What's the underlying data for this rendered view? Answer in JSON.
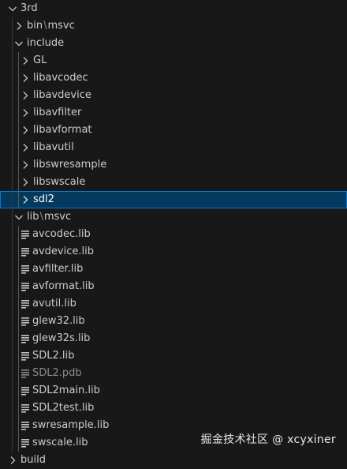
{
  "explorer": {
    "root": {
      "label": "3rd"
    },
    "bin": {
      "part1": "bin",
      "sep": "\\",
      "part2": "msvc"
    },
    "include": {
      "label": "include"
    },
    "include_items": [
      {
        "label": "GL"
      },
      {
        "label": "libavcodec"
      },
      {
        "label": "libavdevice"
      },
      {
        "label": "libavfilter"
      },
      {
        "label": "libavformat"
      },
      {
        "label": "libavutil"
      },
      {
        "label": "libswresample"
      },
      {
        "label": "libswscale"
      },
      {
        "label": "sdl2"
      }
    ],
    "lib": {
      "part1": "lib",
      "sep": "\\",
      "part2": "msvc"
    },
    "lib_files": [
      {
        "label": "avcodec.lib"
      },
      {
        "label": "avdevice.lib"
      },
      {
        "label": "avfilter.lib"
      },
      {
        "label": "avformat.lib"
      },
      {
        "label": "avutil.lib"
      },
      {
        "label": "glew32.lib"
      },
      {
        "label": "glew32s.lib"
      },
      {
        "label": "SDL2.lib"
      },
      {
        "label": "SDL2.pdb"
      },
      {
        "label": "SDL2main.lib"
      },
      {
        "label": "SDL2test.lib"
      },
      {
        "label": "swresample.lib"
      },
      {
        "label": "swscale.lib"
      }
    ],
    "build": {
      "label": "build"
    }
  },
  "watermark": {
    "text": "掘金技术社区 @ xcyxiner"
  },
  "colors": {
    "background": "#181818",
    "selection": "#04395e",
    "selection_border": "#0078d4",
    "text": "#cccccc",
    "dim_text": "#8b8b8b"
  },
  "icons": {
    "expanded": "chevron-down-icon",
    "collapsed": "chevron-right-icon",
    "file": "file-lines-icon"
  }
}
